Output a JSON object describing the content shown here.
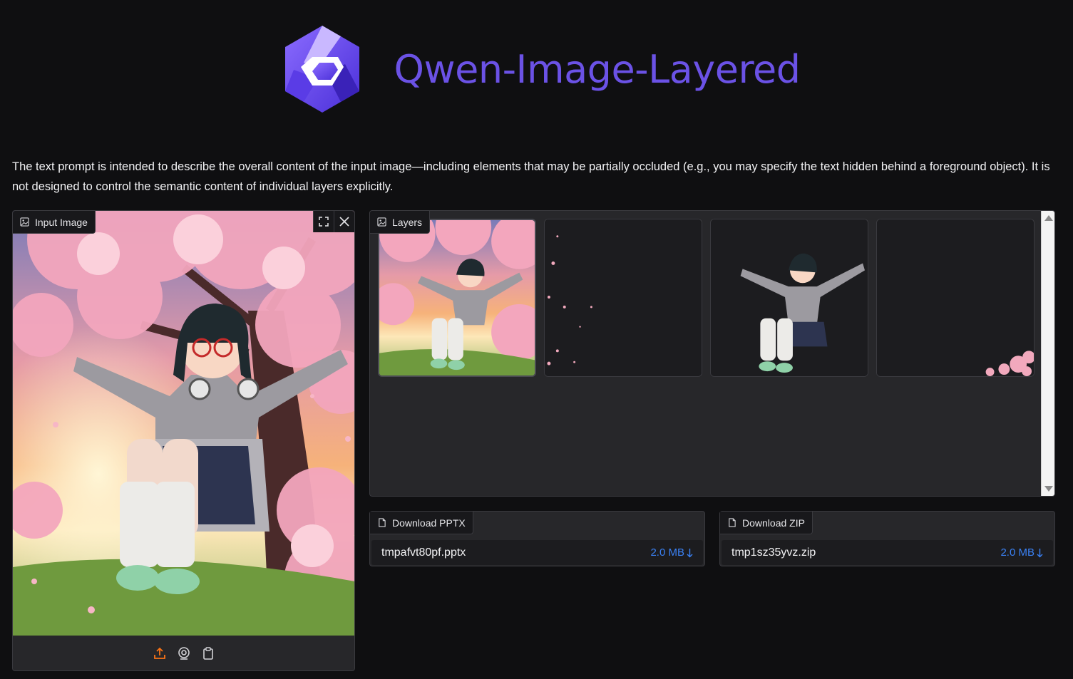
{
  "header": {
    "title": "Qwen-Image-Layered"
  },
  "description": "The text prompt is intended to describe the overall content of the input image—including elements that may be partially occluded (e.g., you may specify the text hidden behind a foreground object). It is not designed to control the semantic content of individual layers explicitly.",
  "input_image": {
    "label": "Input Image",
    "tools": [
      "upload-icon",
      "webcam-icon",
      "clipboard-icon"
    ],
    "accent": "#f97316"
  },
  "layers": {
    "label": "Layers",
    "count": 4
  },
  "downloads": {
    "pptx": {
      "label": "Download PPTX",
      "filename": "tmpafvt80pf.pptx",
      "size": "2.0 MB"
    },
    "zip": {
      "label": "Download ZIP",
      "filename": "tmp1sz35yvz.zip",
      "size": "2.0 MB"
    }
  },
  "colors": {
    "brand": "#6b52e6",
    "link": "#3b82f6",
    "panel": "#27272a",
    "background": "#0f0f11"
  }
}
